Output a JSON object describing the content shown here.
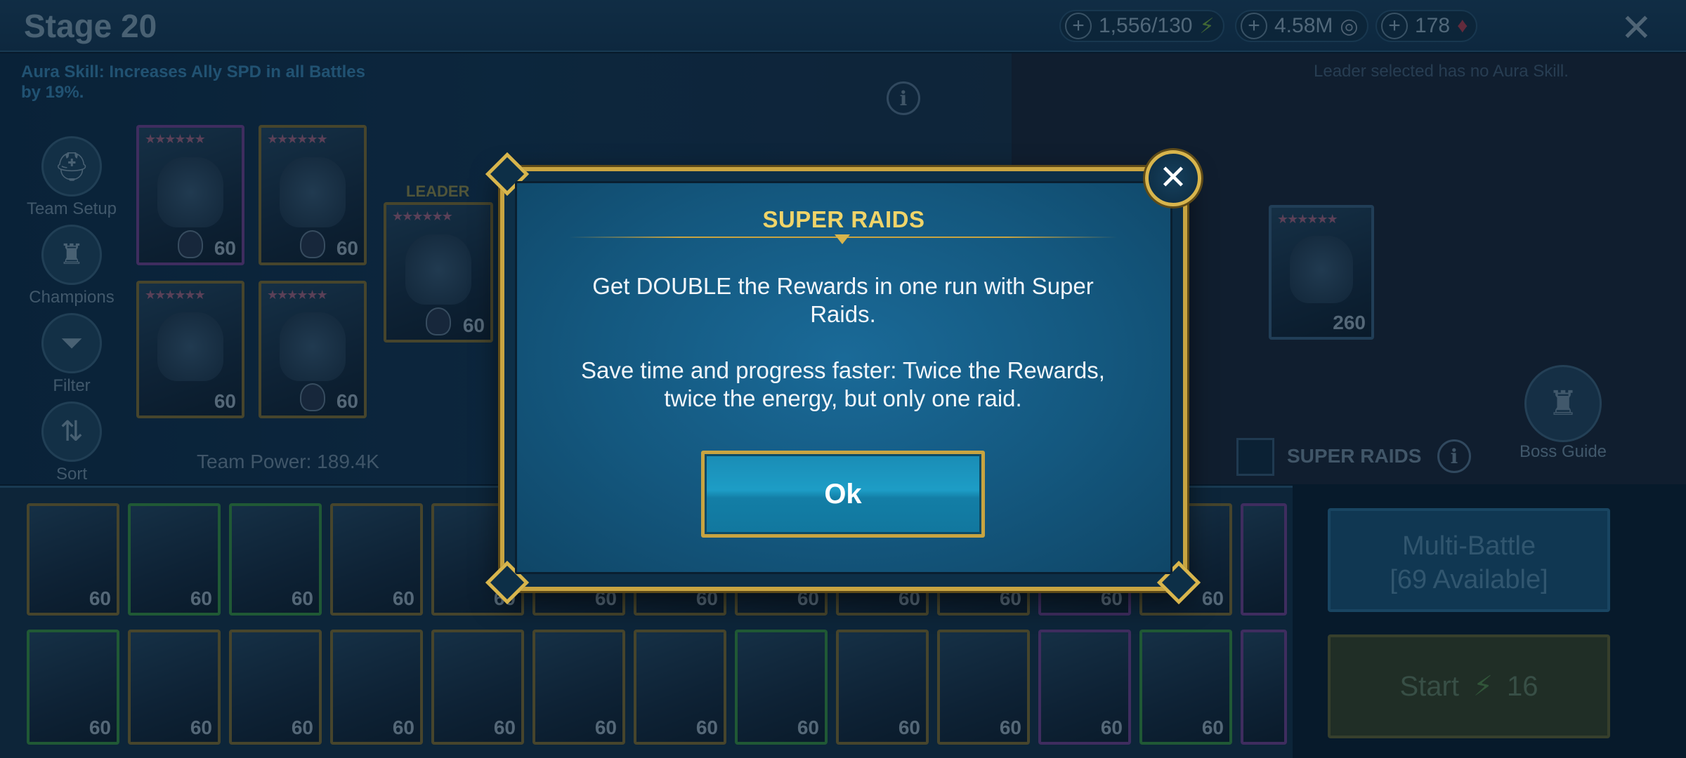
{
  "header": {
    "stage_title": "Stage 20",
    "energy": "1,556/130",
    "silver": "4.58M",
    "gems": "178",
    "plus": "+",
    "close_glyph": "✕"
  },
  "aura": {
    "left": "Aura Skill: Increases Ally SPD in all Battles by 19%.",
    "right": "Leader selected has no Aura Skill."
  },
  "sidebar": {
    "items": [
      {
        "label": "Team Setup",
        "icon": "helmet-icon"
      },
      {
        "label": "Champions",
        "icon": "champion-helmet-icon"
      },
      {
        "label": "Filter",
        "icon": "filter-icon"
      },
      {
        "label": "Sort",
        "icon": "sort-icon"
      }
    ]
  },
  "team": {
    "leader_label": "LEADER",
    "power": "Team Power: 189.4K",
    "slots": [
      {
        "level": "60"
      },
      {
        "level": "60"
      },
      {
        "level": "60"
      },
      {
        "level": "60"
      },
      {
        "level": "60"
      }
    ],
    "enemy_level": "260"
  },
  "super_raids": {
    "checkbox_label": "SUPER RAIDS",
    "checked": false
  },
  "boss_guide": {
    "label": "Boss Guide"
  },
  "roster_levels": [
    "60",
    "60",
    "60",
    "60",
    "60",
    "60",
    "60",
    "60",
    "60",
    "60",
    "60",
    "60",
    "60",
    "60",
    "60",
    "60",
    "60",
    "60",
    "60",
    "60",
    "60",
    "60",
    "60",
    "60",
    "60"
  ],
  "actions": {
    "multi_battle_line1": "Multi-Battle",
    "multi_battle_line2": "[69 Available]",
    "start_label": "Start",
    "start_cost": "16"
  },
  "modal": {
    "title": "SUPER RAIDS",
    "paragraph1_line1": "Get DOUBLE the Rewards in one run with Super",
    "paragraph1_line2": "Raids.",
    "paragraph2_line1": "Save time and progress faster: Twice the Rewards,",
    "paragraph2_line2": "twice the energy, but only one raid.",
    "ok_label": "Ok",
    "close_glyph": "✕"
  },
  "colors": {
    "gold_frame": "#c8a441",
    "title_gold": "#f0d469",
    "modal_blue": "#14587f",
    "ok_blue": "#1a8cb5"
  }
}
